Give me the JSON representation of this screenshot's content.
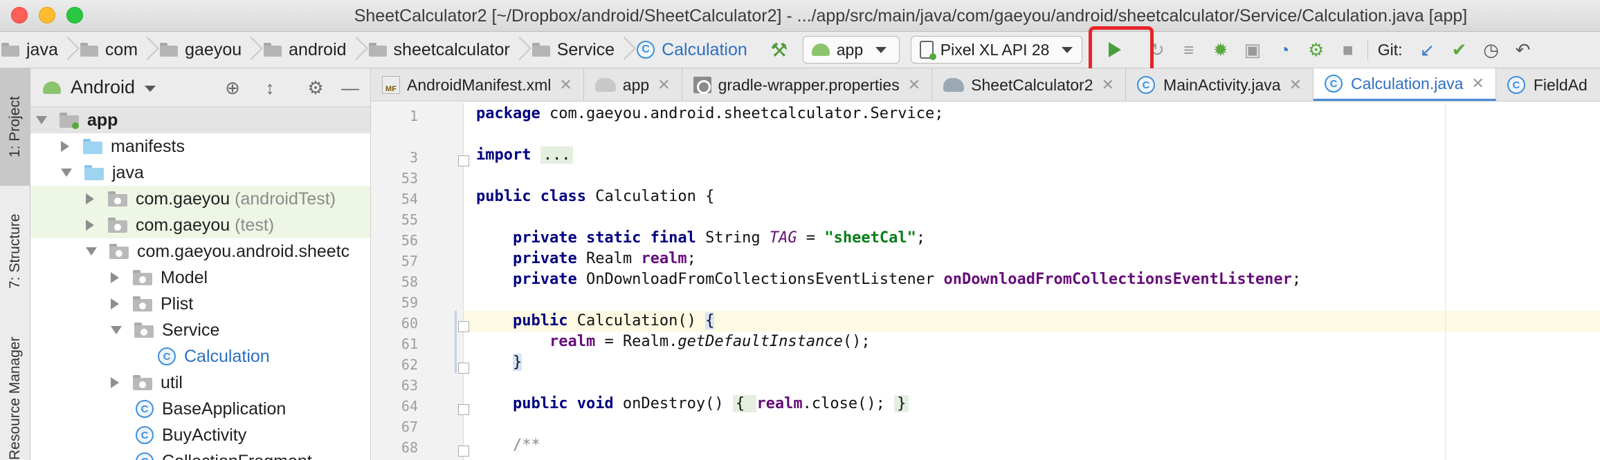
{
  "window": {
    "title": "SheetCalculator2 [~/Dropbox/android/SheetCalculator2] - .../app/src/main/java/com/gaeyou/android/sheetcalculator/Service/Calculation.java [app]"
  },
  "breadcrumbs": [
    "java",
    "com",
    "gaeyou",
    "android",
    "sheetcalculator",
    "Service",
    "Calculation"
  ],
  "toolbar": {
    "module": "app",
    "device": "Pixel XL API 28",
    "git_label": "Git:"
  },
  "toolstrip": {
    "project_tab": "1: Project",
    "structure_tab": "7: Structure",
    "resource_tab": "Resource Manager"
  },
  "project": {
    "view_title": "Android",
    "tree": [
      {
        "label": "app",
        "hint": ""
      },
      {
        "label": "manifests",
        "hint": ""
      },
      {
        "label": "java",
        "hint": ""
      },
      {
        "label": "com.gaeyou",
        "hint": "(androidTest)"
      },
      {
        "label": "com.gaeyou",
        "hint": "(test)"
      },
      {
        "label": "com.gaeyou.android.sheetc",
        "hint": ""
      },
      {
        "label": "Model",
        "hint": ""
      },
      {
        "label": "Plist",
        "hint": ""
      },
      {
        "label": "Service",
        "hint": ""
      },
      {
        "label": "Calculation",
        "hint": ""
      },
      {
        "label": "util",
        "hint": ""
      },
      {
        "label": "BaseApplication",
        "hint": ""
      },
      {
        "label": "BuyActivity",
        "hint": ""
      },
      {
        "label": "CollectionFragment",
        "hint": ""
      }
    ]
  },
  "tabs": [
    {
      "label": "AndroidManifest.xml"
    },
    {
      "label": "app"
    },
    {
      "label": "gradle-wrapper.properties"
    },
    {
      "label": "SheetCalculator2"
    },
    {
      "label": "MainActivity.java"
    },
    {
      "label": "Calculation.java"
    },
    {
      "label": "FieldAd"
    }
  ],
  "editor": {
    "line_numbers": [
      "1",
      "",
      "3",
      "53",
      "54",
      "55",
      "56",
      "57",
      "58",
      "59",
      "60",
      "61",
      "62",
      "63",
      "64",
      "67",
      "68"
    ],
    "code": {
      "l1_kw": "package",
      "l1_rest": " com.gaeyou.android.sheetcalculator.Service;",
      "l3_kw": "import",
      "l3_fold": "...",
      "l54_kw": "public class",
      "l54_rest": " Calculation {",
      "l56_kw": "private static final",
      "l56_type": " String ",
      "l56_name": "TAG",
      "l56_eq": " = ",
      "l56_str": "\"sheetCal\"",
      "l56_end": ";",
      "l57_kw": "private",
      "l57_type": " Realm ",
      "l57_fld": "realm",
      "l57_end": ";",
      "l58_kw": "private",
      "l58_type": " OnDownloadFromCollectionsEventListener ",
      "l58_fld": "onDownloadFromCollectionsEventListener",
      "l58_end": ";",
      "l60_kw": "public",
      "l60_rest": " Calculation() ",
      "l60_brace": "{",
      "l61_fld": "realm",
      "l61_mid": " = Realm.",
      "l61_it": "getDefaultInstance",
      "l61_end": "();",
      "l62_brace": "}",
      "l64_kw": "public void",
      "l64_rest": " onDestroy() ",
      "l64_fold1": "{ ",
      "l64_fld": "realm",
      "l64_mid": ".close(); ",
      "l64_fold2": "}",
      "l68_cmt": "/**"
    }
  }
}
